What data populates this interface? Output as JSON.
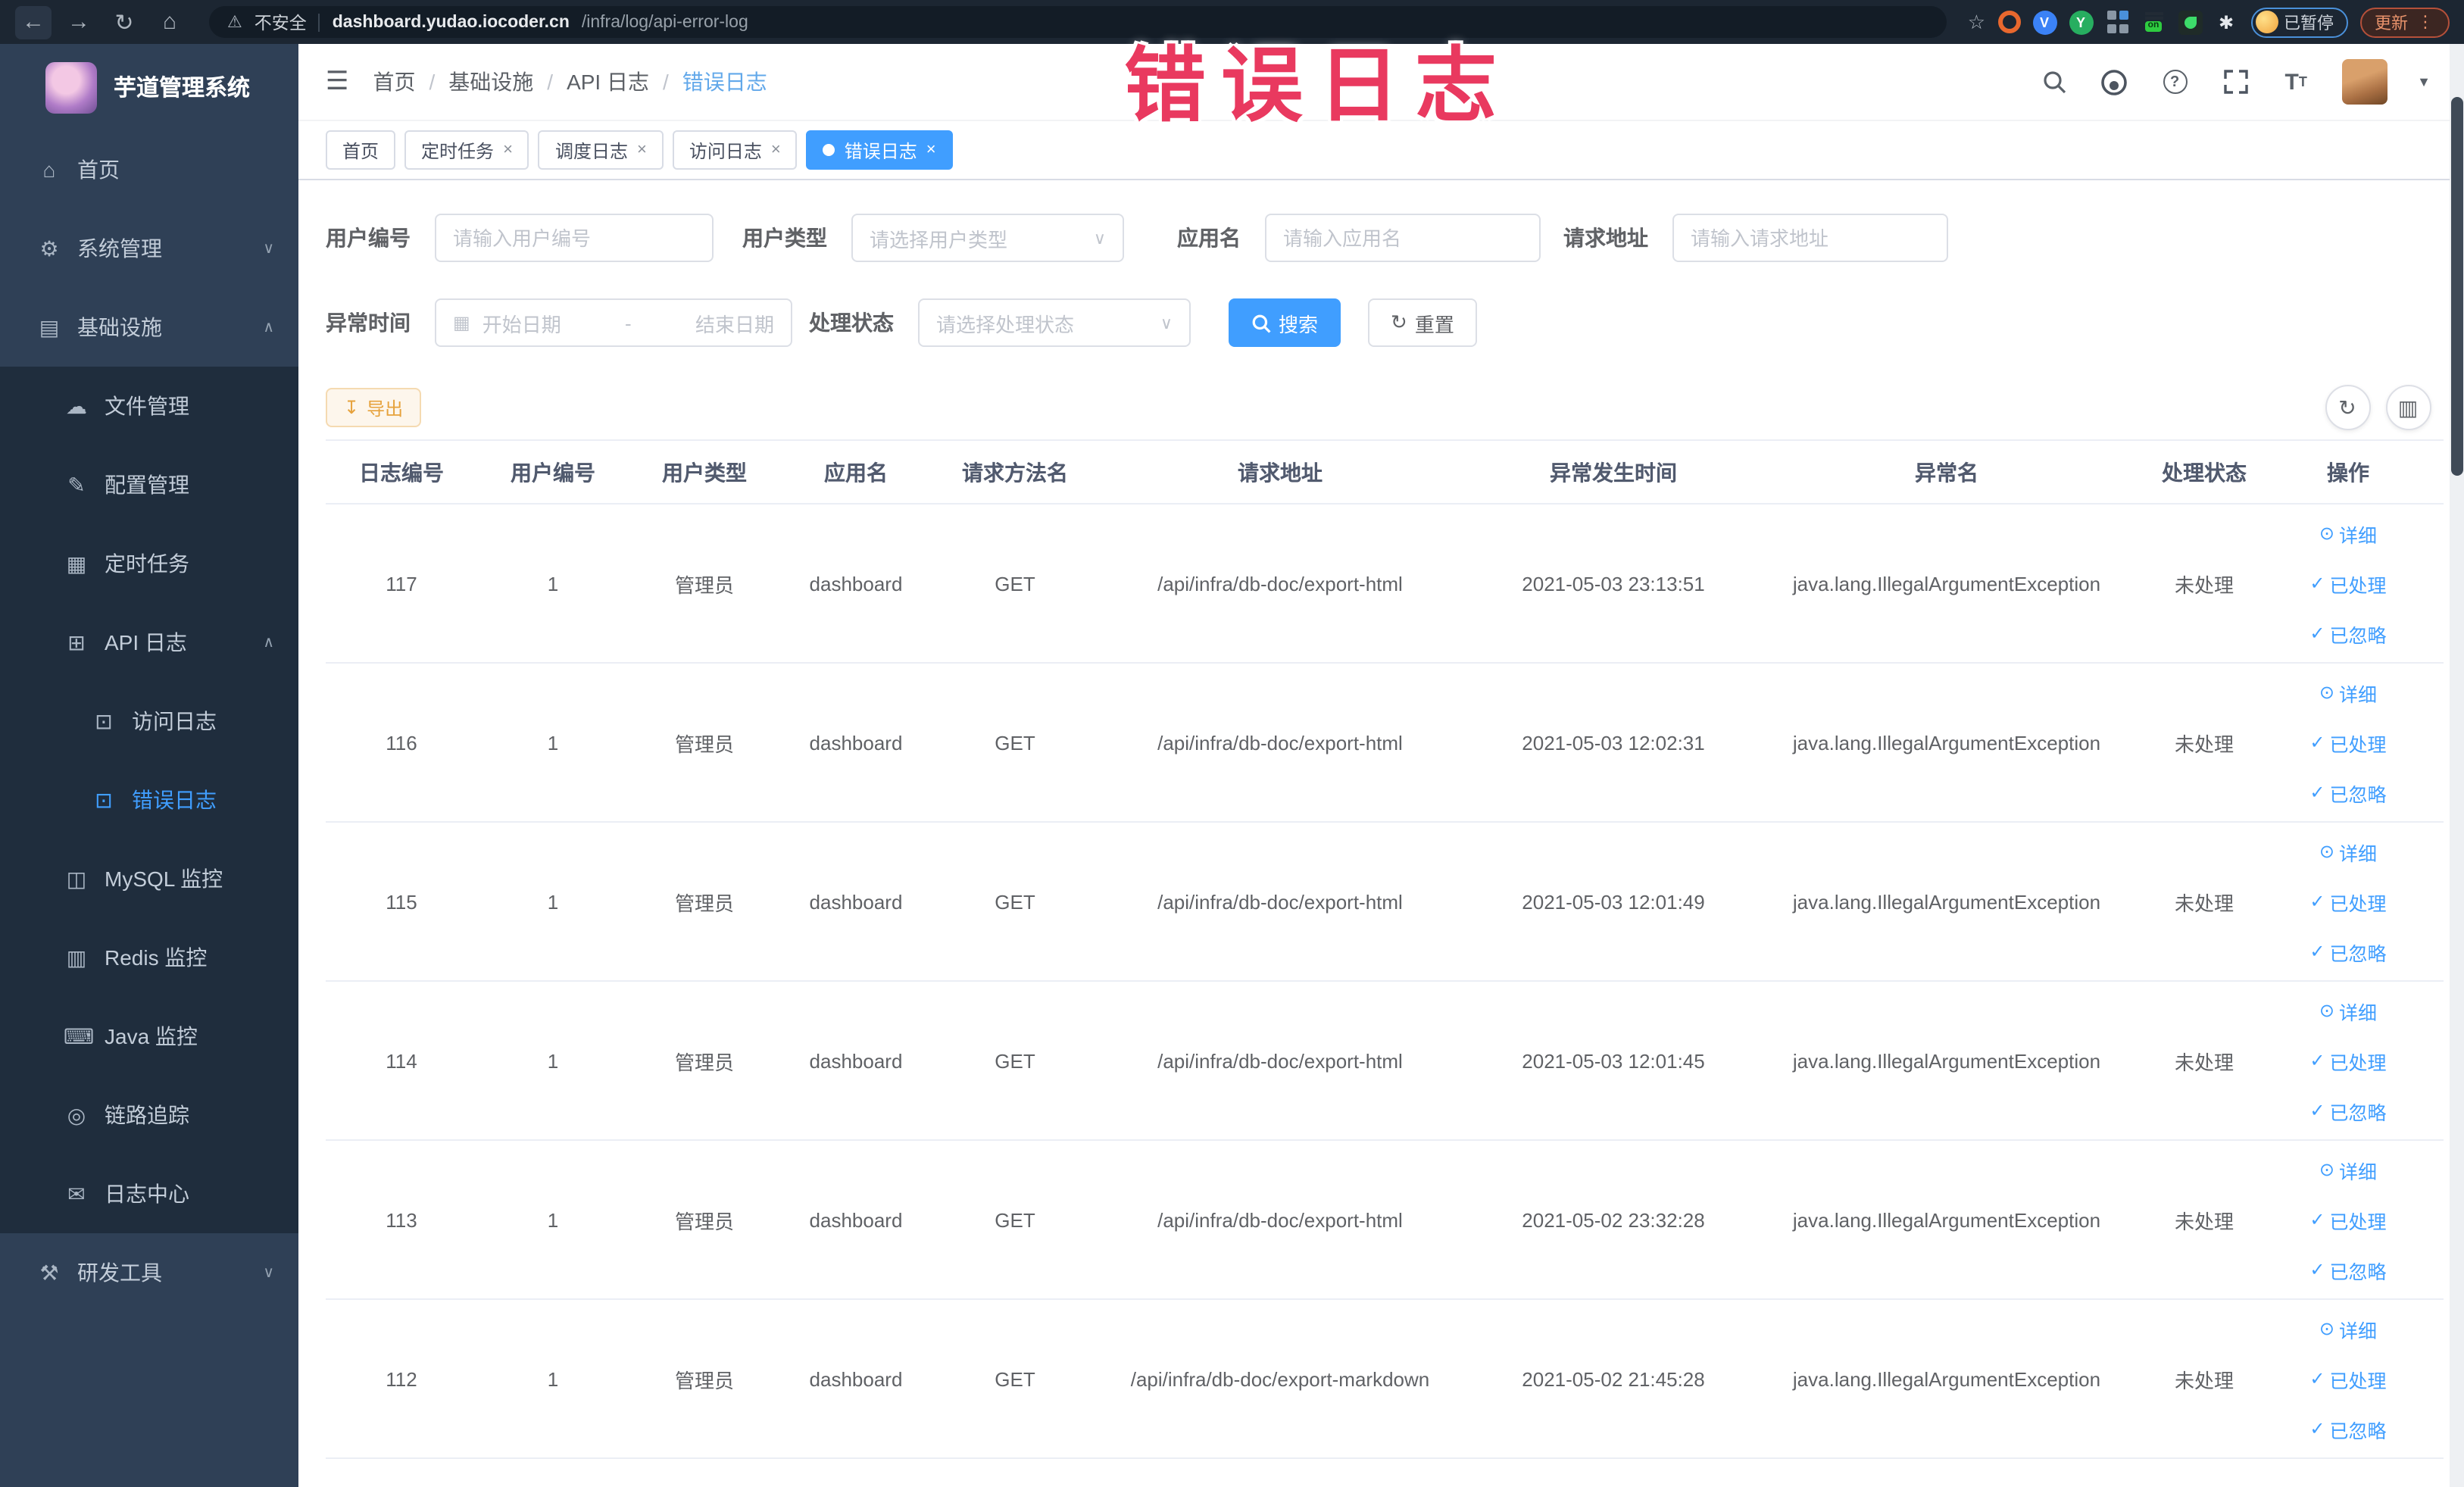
{
  "browser": {
    "security_label": "不安全",
    "url_domain": "dashboard.yudao.iocoder.cn",
    "url_path": "/infra/log/api-error-log",
    "profile_chip": "已暂停",
    "update_button": "更新",
    "extensions": [
      "orange-ring-extension",
      "shield-extension",
      "green-y-extension",
      "grid-extension",
      "proxy-on-extension",
      "leaf-extension",
      "pin-extension"
    ]
  },
  "annotation": {
    "text": "错误日志",
    "color": "#e9395f"
  },
  "sidebar": {
    "logo_title": "芋道管理系统",
    "items": [
      {
        "label": "首页",
        "icon": "home-icon",
        "glyph": "⌂",
        "level": 1
      },
      {
        "label": "系统管理",
        "icon": "system-manage-icon",
        "glyph": "⚙",
        "level": 1,
        "chevron": "down"
      },
      {
        "label": "基础设施",
        "icon": "infrastructure-icon",
        "glyph": "▤",
        "level": 1,
        "chevron": "up"
      },
      {
        "label": "文件管理",
        "icon": "file-manage-icon",
        "glyph": "☁",
        "level": 2,
        "submenu": true
      },
      {
        "label": "配置管理",
        "icon": "config-manage-icon",
        "glyph": "✎",
        "level": 2,
        "submenu": true
      },
      {
        "label": "定时任务",
        "icon": "scheduled-job-icon",
        "glyph": "▦",
        "level": 2,
        "submenu": true
      },
      {
        "label": "API 日志",
        "icon": "api-log-icon",
        "glyph": "⊞",
        "level": 2,
        "chevron": "up",
        "submenu": true
      },
      {
        "label": "访问日志",
        "icon": "access-log-icon",
        "glyph": "⊡",
        "level": 3,
        "submenu": true
      },
      {
        "label": "错误日志",
        "icon": "error-log-icon",
        "glyph": "⊡",
        "level": 3,
        "submenu": true,
        "active": true
      },
      {
        "label": "MySQL 监控",
        "icon": "mysql-monitor-icon",
        "glyph": "◫",
        "level": 2,
        "submenu": true
      },
      {
        "label": "Redis 监控",
        "icon": "redis-monitor-icon",
        "glyph": "▥",
        "level": 2,
        "submenu": true
      },
      {
        "label": "Java 监控",
        "icon": "java-monitor-icon",
        "glyph": "⌨",
        "level": 2,
        "submenu": true
      },
      {
        "label": "链路追踪",
        "icon": "trace-icon",
        "glyph": "◎",
        "level": 2,
        "submenu": true
      },
      {
        "label": "日志中心",
        "icon": "log-center-icon",
        "glyph": "✉",
        "level": 2,
        "submenu": true
      },
      {
        "label": "研发工具",
        "icon": "devtools-icon",
        "glyph": "⚒",
        "level": 1,
        "chevron": "down"
      }
    ]
  },
  "topbar": {
    "breadcrumb": [
      "首页",
      "基础设施",
      "API 日志",
      "错误日志"
    ]
  },
  "tabs": [
    {
      "label": "首页",
      "closable": false,
      "active": false
    },
    {
      "label": "定时任务",
      "closable": true,
      "active": false
    },
    {
      "label": "调度日志",
      "closable": true,
      "active": false
    },
    {
      "label": "访问日志",
      "closable": true,
      "active": false
    },
    {
      "label": "错误日志",
      "closable": true,
      "active": true
    }
  ],
  "filters": {
    "user_id_label": "用户编号",
    "user_id_placeholder": "请输入用户编号",
    "user_type_label": "用户类型",
    "user_type_placeholder": "请选择用户类型",
    "app_name_label": "应用名",
    "app_name_placeholder": "请输入应用名",
    "request_url_label": "请求地址",
    "request_url_placeholder": "请输入请求地址",
    "exception_time_label": "异常时间",
    "date_start_placeholder": "开始日期",
    "date_separator": "-",
    "date_end_placeholder": "结束日期",
    "process_status_label": "处理状态",
    "process_status_placeholder": "请选择处理状态",
    "search_button": "搜索",
    "reset_button": "重置"
  },
  "toolbar": {
    "export_button": "导出"
  },
  "table": {
    "columns": [
      "日志编号",
      "用户编号",
      "用户类型",
      "应用名",
      "请求方法名",
      "请求地址",
      "异常发生时间",
      "异常名",
      "处理状态",
      "操作"
    ],
    "actions": [
      "详细",
      "已处理",
      "已忽略"
    ],
    "rows": [
      {
        "id": "117",
        "user_id": "1",
        "user_type": "管理员",
        "app": "dashboard",
        "method": "GET",
        "url": "/api/infra/db-doc/export-html",
        "time": "2021-05-03 23:13:51",
        "exception": "java.lang.IllegalArgumentException",
        "status": "未处理"
      },
      {
        "id": "116",
        "user_id": "1",
        "user_type": "管理员",
        "app": "dashboard",
        "method": "GET",
        "url": "/api/infra/db-doc/export-html",
        "time": "2021-05-03 12:02:31",
        "exception": "java.lang.IllegalArgumentException",
        "status": "未处理"
      },
      {
        "id": "115",
        "user_id": "1",
        "user_type": "管理员",
        "app": "dashboard",
        "method": "GET",
        "url": "/api/infra/db-doc/export-html",
        "time": "2021-05-03 12:01:49",
        "exception": "java.lang.IllegalArgumentException",
        "status": "未处理"
      },
      {
        "id": "114",
        "user_id": "1",
        "user_type": "管理员",
        "app": "dashboard",
        "method": "GET",
        "url": "/api/infra/db-doc/export-html",
        "time": "2021-05-03 12:01:45",
        "exception": "java.lang.IllegalArgumentException",
        "status": "未处理"
      },
      {
        "id": "113",
        "user_id": "1",
        "user_type": "管理员",
        "app": "dashboard",
        "method": "GET",
        "url": "/api/infra/db-doc/export-html",
        "time": "2021-05-02 23:32:28",
        "exception": "java.lang.IllegalArgumentException",
        "status": "未处理"
      },
      {
        "id": "112",
        "user_id": "1",
        "user_type": "管理员",
        "app": "dashboard",
        "method": "GET",
        "url": "/api/infra/db-doc/export-markdown",
        "time": "2021-05-02 21:45:28",
        "exception": "java.lang.IllegalArgumentException",
        "status": "未处理"
      }
    ]
  },
  "colors": {
    "primary": "#409eff",
    "annotation": "#e9395f",
    "warning": "#e6a23c",
    "sidebar": "#2f4056",
    "submenu": "#1f2d3d"
  }
}
